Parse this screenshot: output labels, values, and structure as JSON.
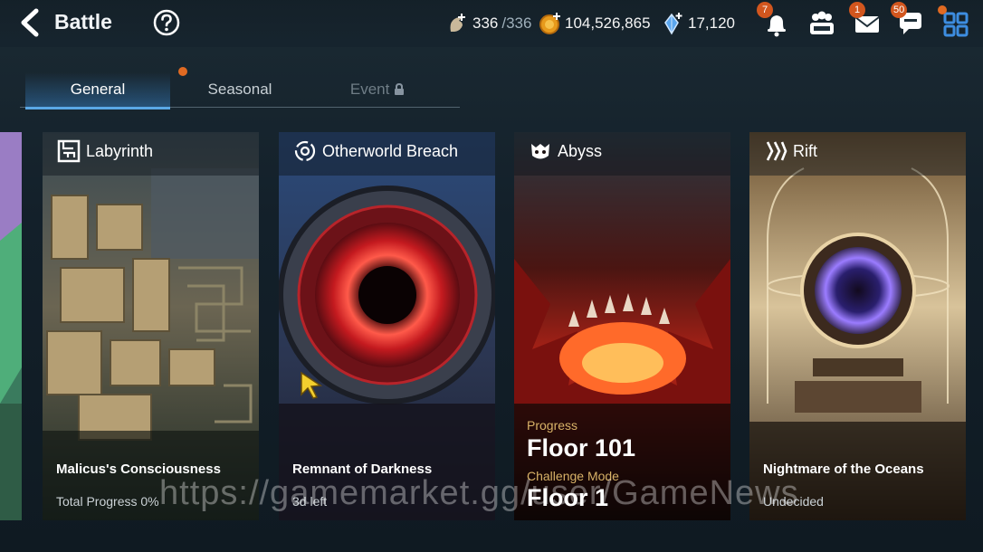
{
  "header": {
    "title": "Battle",
    "stamina": {
      "value": "336",
      "max": "/336"
    },
    "gold": "104,526,865",
    "skystones": "17,120",
    "notifications_badge": "7",
    "mail_badge": "1",
    "chat_badge": "50"
  },
  "tabs": [
    {
      "label": "General",
      "active": true
    },
    {
      "label": "Seasonal",
      "active": false
    },
    {
      "label": "Event",
      "locked": true
    }
  ],
  "cards": [
    {
      "name": "Labyrinth",
      "icon": "maze-icon",
      "subtitle": "Malicus's Consciousness",
      "detail": "Total Progress 0%"
    },
    {
      "name": "Otherworld Breach",
      "icon": "swirl-icon",
      "subtitle": "Remnant of Darkness",
      "detail": "3d left"
    },
    {
      "name": "Abyss",
      "icon": "demon-icon",
      "progress_label": "Progress",
      "progress_value": "Floor 101",
      "mode_label": "Challenge Mode",
      "mode_value": "Floor 1"
    },
    {
      "name": "Rift",
      "icon": "rift-icon",
      "subtitle": "Nightmare of the Oceans",
      "detail": "Undecided"
    }
  ],
  "watermark": "https://gamemarket.gg/user/GameNews",
  "colors": {
    "accent": "#5aa8e6",
    "badge": "#d2561e",
    "gold_label": "#d8b267"
  }
}
